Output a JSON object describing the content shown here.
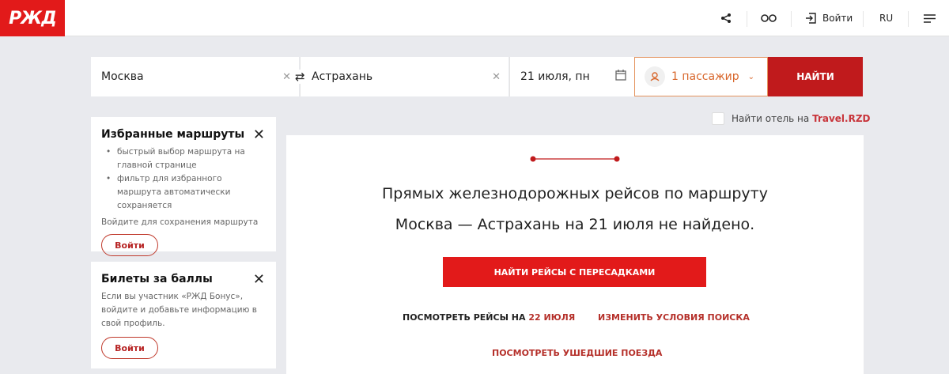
{
  "header": {
    "logo": "РЖД",
    "login": "Войти",
    "lang": "RU"
  },
  "search": {
    "from": "Москва",
    "to": "Астрахань",
    "date": "21 июля, пн",
    "passengers": "1 пассажир",
    "find": "НАЙТИ"
  },
  "hotel": {
    "label": "Найти отель на ",
    "link": "Travel.RZD"
  },
  "favorites": {
    "title": "Избранные маршруты",
    "bullets": [
      "быстрый выбор маршрута на главной странице",
      "фильтр для избранного маршрута автоматически сохраняется"
    ],
    "note": "Войдите для сохранения маршрута",
    "button": "Войти"
  },
  "bonus": {
    "title": "Билеты за баллы",
    "text": "Если вы участник «РЖД Бонус», войдите и добавьте информацию в свой профиль.",
    "button": "Войти"
  },
  "result": {
    "message": "Прямых железнодорожных рейсов по маршруту Москва — Астрахань на 21 июля не найдено.",
    "transfers": "НАЙТИ РЕЙСЫ С ПЕРЕСАДКАМИ",
    "view_prefix": "ПОСМОТРЕТЬ РЕЙСЫ НА ",
    "view_date": "22 ИЮЛЯ",
    "change": "ИЗМЕНИТЬ УСЛОВИЯ ПОИСКА",
    "departed": "ПОСМОТРЕТЬ УШЕДШИЕ ПОЕЗДА"
  },
  "colors": {
    "brand": "#e21a1a",
    "find": "#c01a1c",
    "accent": "#e4935e"
  }
}
